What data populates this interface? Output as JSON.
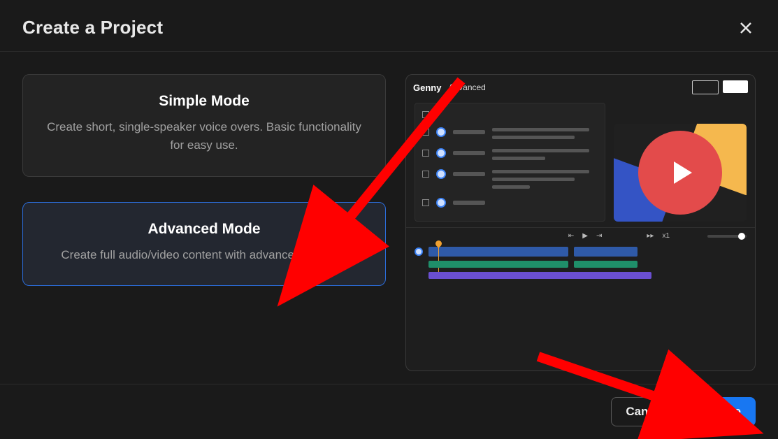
{
  "dialog": {
    "title": "Create a Project"
  },
  "modes": {
    "simple": {
      "title": "Simple Mode",
      "description": "Create short, single-speaker voice overs. Basic functionality for easy use."
    },
    "advanced": {
      "title": "Advanced Mode",
      "description": "Create full audio/video content with advanced features"
    }
  },
  "preview": {
    "brand": "Genny",
    "tab_label": "Advanced",
    "transport_speed": "x1"
  },
  "footer": {
    "cancel_label": "Cancel",
    "create_label": "Create"
  },
  "colors": {
    "primary": "#1877f2",
    "annotation": "#ff0000"
  }
}
